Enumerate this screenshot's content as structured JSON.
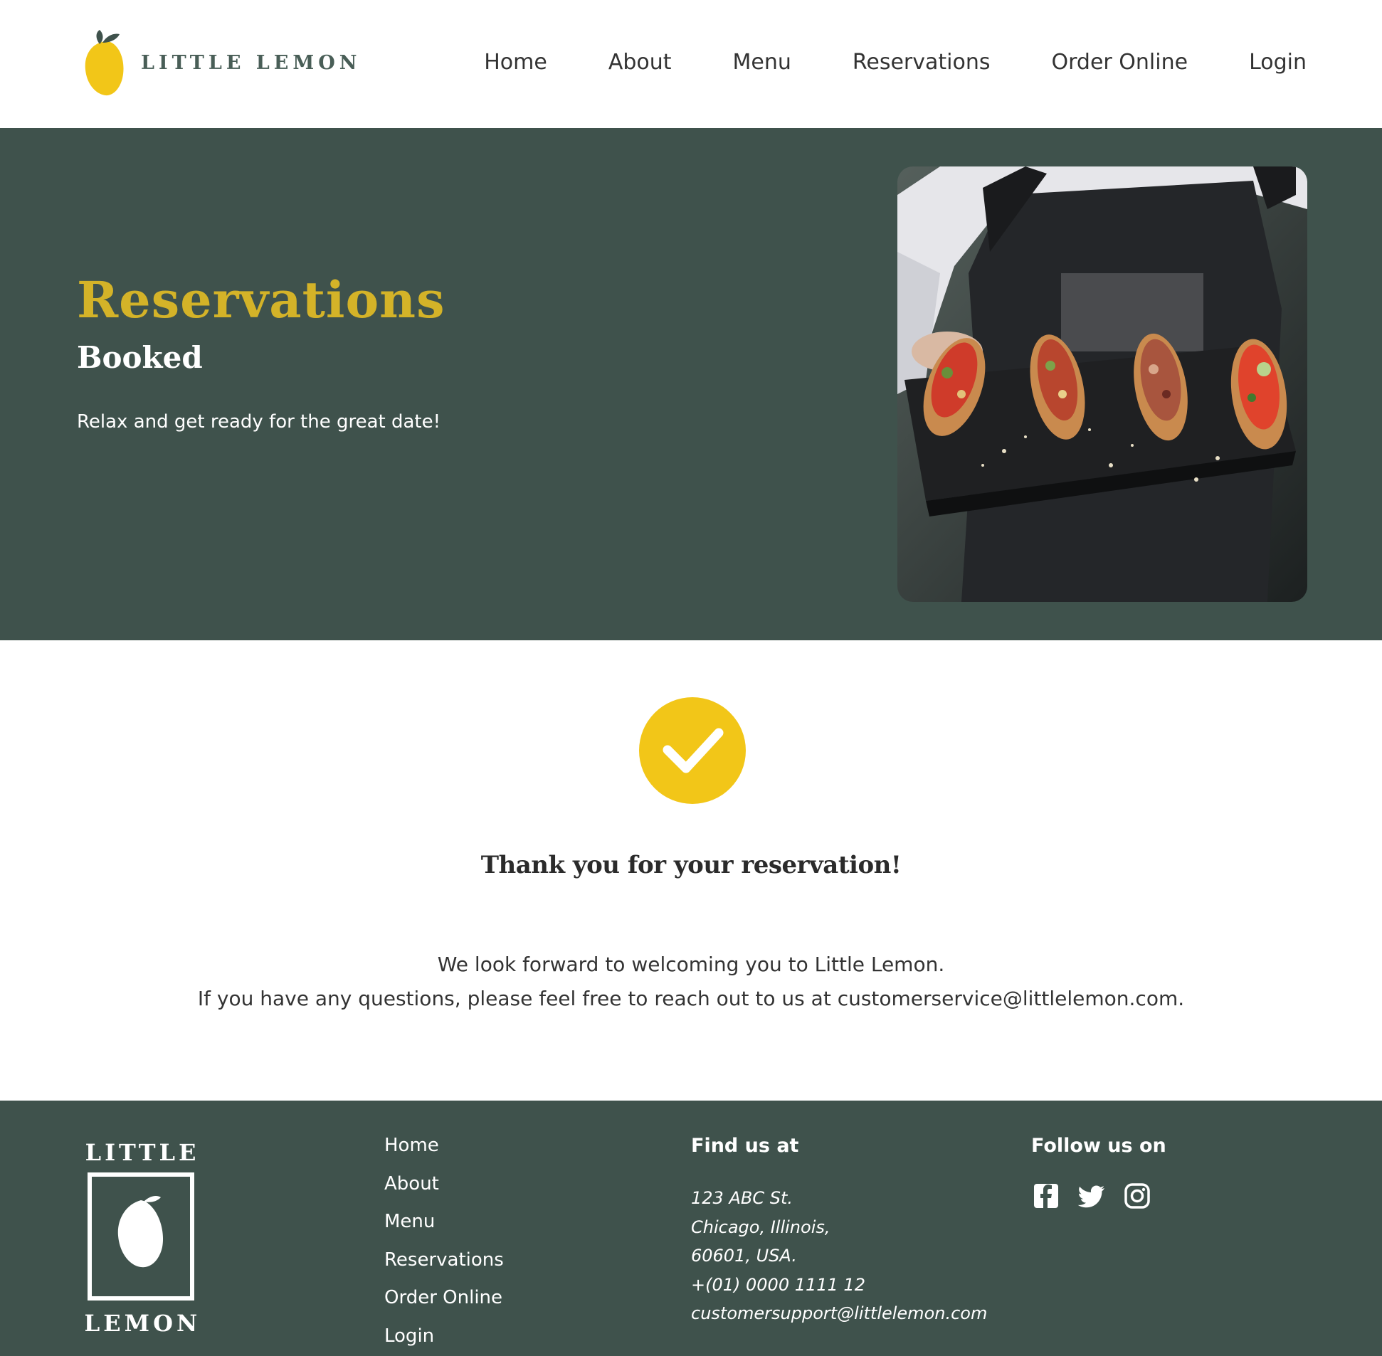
{
  "brand": {
    "name": "LITTLE LEMON"
  },
  "nav": {
    "home": "Home",
    "about": "About",
    "menu": "Menu",
    "reservations": "Reservations",
    "order_online": "Order Online",
    "login": "Login"
  },
  "hero": {
    "title": "Reservations",
    "subtitle": "Booked",
    "text": "Relax and get ready for the great date!"
  },
  "confirmation": {
    "title": "Thank you for your reservation!",
    "line1": "We look forward to welcoming you to Little Lemon.",
    "line2": "If you have any questions, please feel free to reach out to us at customerservice@littlelemon.com."
  },
  "footer": {
    "logo_top": "LITTLE",
    "logo_bottom": "LEMON",
    "nav": [
      "Home",
      "About",
      "Menu",
      "Reservations",
      "Order Online",
      "Login"
    ],
    "find_title": "Find us at",
    "address": {
      "street": "123 ABC St.",
      "city": "Chicago, Illinois,",
      "zip": "60601, USA.",
      "phone": "+(01) 0000 1111 12",
      "email": "customersupport@littlelemon.com"
    },
    "follow_title": "Follow us on",
    "socials": [
      "facebook-icon",
      "twitter-icon",
      "instagram-icon"
    ]
  },
  "colors": {
    "primary_green": "#3f524c",
    "brand_yellow": "#f2c618",
    "title_yellow": "#d4b328"
  }
}
